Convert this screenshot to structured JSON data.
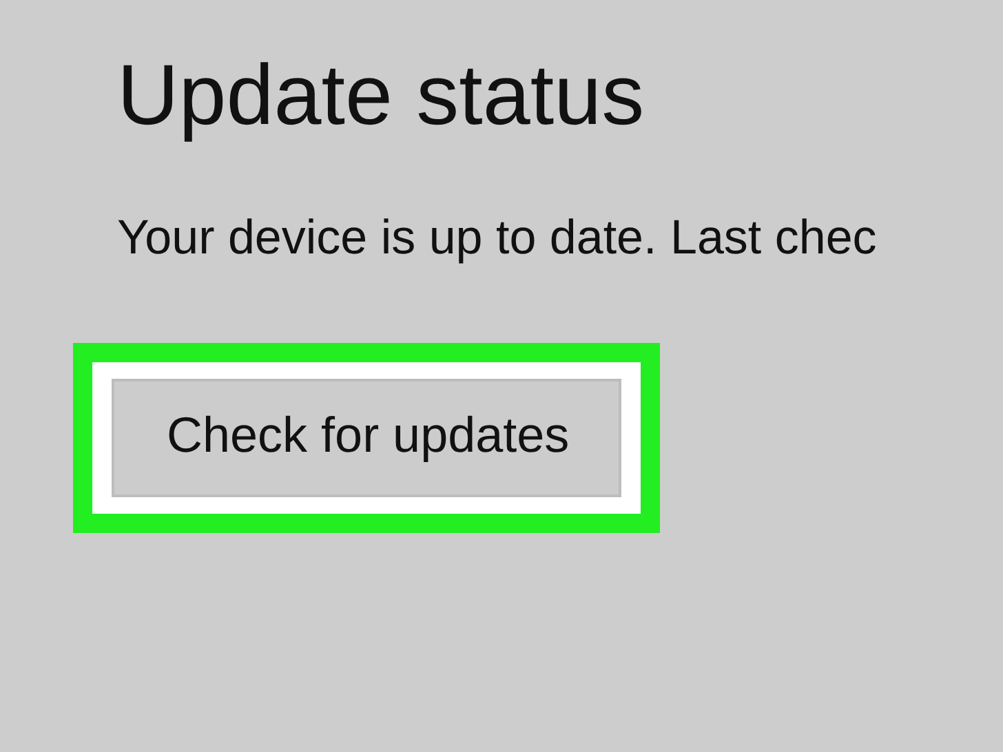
{
  "title": "Update status",
  "status_text": "Your device is up to date. Last chec",
  "button": {
    "label": "Check for updates",
    "highlighted": true
  }
}
